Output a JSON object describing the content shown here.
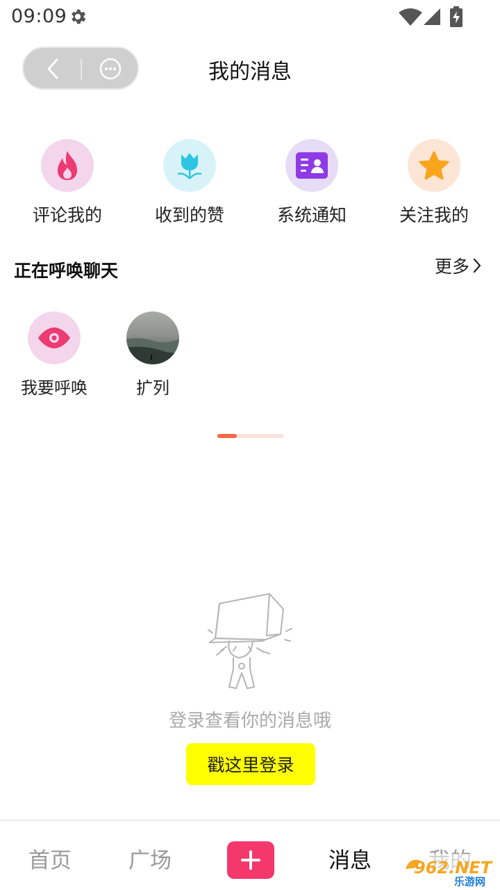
{
  "status_bar": {
    "time": "09:09"
  },
  "header": {
    "title": "我的消息"
  },
  "quick_entries": [
    {
      "label": "评论我的",
      "icon": "fire-icon",
      "color": "#ec3a72"
    },
    {
      "label": "收到的赞",
      "icon": "tulip-icon",
      "color": "#2ec5e4"
    },
    {
      "label": "系统通知",
      "icon": "id-card-icon",
      "color": "#8e3be6"
    },
    {
      "label": "关注我的",
      "icon": "star-icon",
      "color": "#f9a51c"
    }
  ],
  "calls_section": {
    "title": "正在呼唤聊天",
    "more_label": "更多"
  },
  "calls": [
    {
      "label": "我要呼唤",
      "icon": "eye-icon"
    },
    {
      "label": "扩列",
      "icon": "avatar-photo"
    }
  ],
  "pager": {
    "progress": 0.29
  },
  "empty_state": {
    "message": "登录查看你的消息哦",
    "button_label": "戳这里登录"
  },
  "tabbar": {
    "items": [
      {
        "label": "首页",
        "active": false
      },
      {
        "label": "广场",
        "active": false
      },
      {
        "label": "消息",
        "active": true
      },
      {
        "label": "我的",
        "active": false
      }
    ]
  },
  "watermark": {
    "text_top": "962.NET",
    "text_bottom": "乐游网"
  },
  "colors": {
    "login_button": "#ffff00",
    "plus_button": "#f4386c",
    "pager": "#f26a47"
  }
}
